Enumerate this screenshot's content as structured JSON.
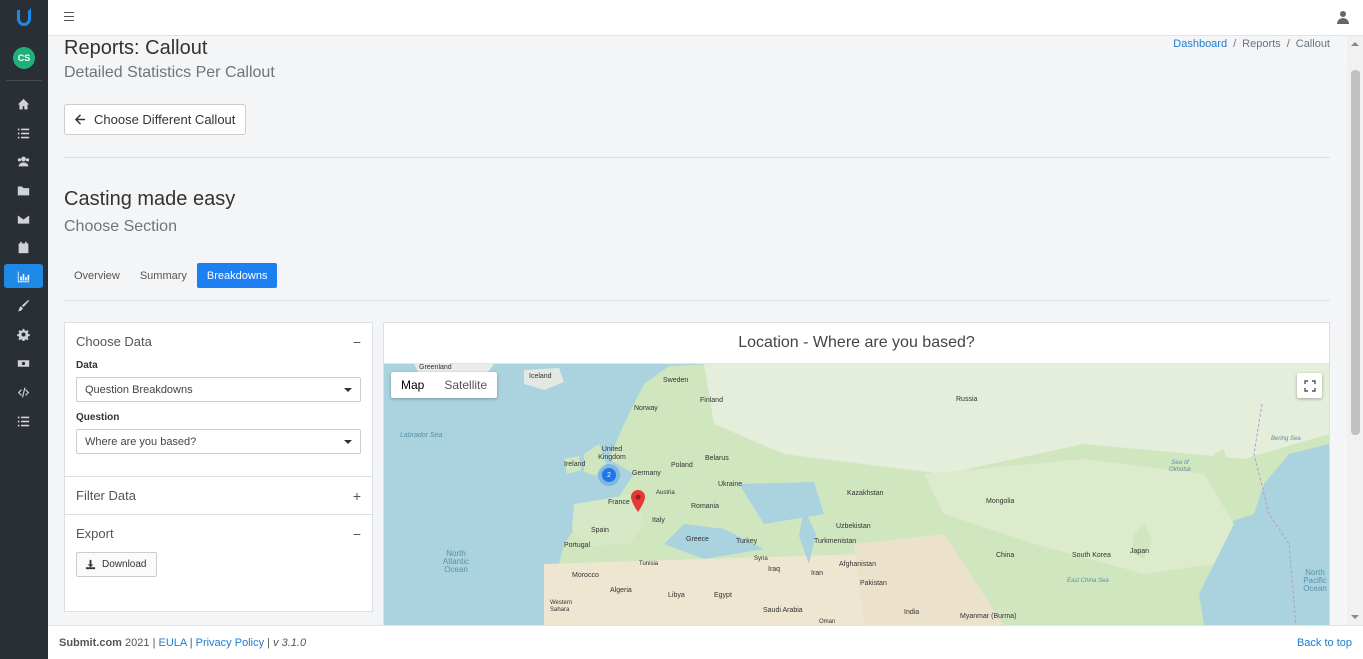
{
  "app": {
    "avatar_initials": "CS",
    "nav": [
      "home-icon",
      "list-icon",
      "users-icon",
      "folder-icon",
      "mail-icon",
      "calendar-icon",
      "chart-icon",
      "brush-icon",
      "gear-icon",
      "money-icon",
      "code-icon",
      "list-alt-icon"
    ],
    "active_nav": "chart-icon"
  },
  "header": {
    "title": "Reports: Callout",
    "subtitle": "Detailed Statistics Per Callout",
    "breadcrumb": {
      "dashboard": "Dashboard",
      "sep": "/",
      "reports": "Reports",
      "callout": "Callout"
    },
    "back_button": "Choose Different Callout"
  },
  "callout": {
    "title": "Casting made easy",
    "subtitle": "Choose Section",
    "tabs": {
      "overview": "Overview",
      "summary": "Summary",
      "breakdowns": "Breakdowns"
    },
    "active_tab": "Breakdowns"
  },
  "panel": {
    "choose_data": "Choose Data",
    "collapse_sign": "−",
    "expand_sign": "+",
    "data_label": "Data",
    "data_value": "Question Breakdowns",
    "question_label": "Question",
    "question_value": "Where are you based?",
    "filter_data": "Filter Data",
    "export": "Export",
    "download": "Download"
  },
  "map": {
    "title": "Location - Where are you based?",
    "map_label": "Map",
    "satellite_label": "Satellite",
    "cluster_count": "2",
    "labels": {
      "greenland": "Greenland",
      "iceland": "Iceland",
      "sweden": "Sweden",
      "finland": "Finland",
      "norway": "Norway",
      "russia": "Russia",
      "labrador": "Labrador Sea",
      "uk": "United Kingdom",
      "ireland": "Ireland",
      "belarus": "Belarus",
      "germany": "Germany",
      "poland": "Poland",
      "ukraine": "Ukraine",
      "france": "France",
      "austria": "Austria",
      "romania": "Romania",
      "italy": "Italy",
      "spain": "Spain",
      "portugal": "Portugal",
      "greece": "Greece",
      "turkey": "Turkey",
      "kazakhstan": "Kazakhstan",
      "uzbekistan": "Uzbekistan",
      "turkmenistan": "Turkmenistan",
      "mongolia": "Mongolia",
      "china": "China",
      "south_korea": "South Korea",
      "japan": "Japan",
      "afghanistan": "Afghanistan",
      "pakistan": "Pakistan",
      "iran": "Iran",
      "iraq": "Iraq",
      "syria": "Syria",
      "tunisia": "Tunisia",
      "morocco": "Morocco",
      "algeria": "Algeria",
      "libya": "Libya",
      "egypt": "Egypt",
      "saudi": "Saudi Arabia",
      "india": "India",
      "myanmar": "Myanmar (Burma)",
      "oman": "Oman",
      "western_sahara": "Western Sahara",
      "north_atlantic": "North Atlantic Ocean",
      "bering": "Bering Sea",
      "okhotsk": "Sea of Okhotsk",
      "east_china": "East China Sea",
      "north_pacific": "North Pacific Ocean"
    }
  },
  "footer": {
    "brand": "Submit.com",
    "year": "2021",
    "sep": "|",
    "eula": "EULA",
    "privacy": "Privacy Policy",
    "version": "v 3.1.0",
    "back_to_top": "Back to top"
  }
}
